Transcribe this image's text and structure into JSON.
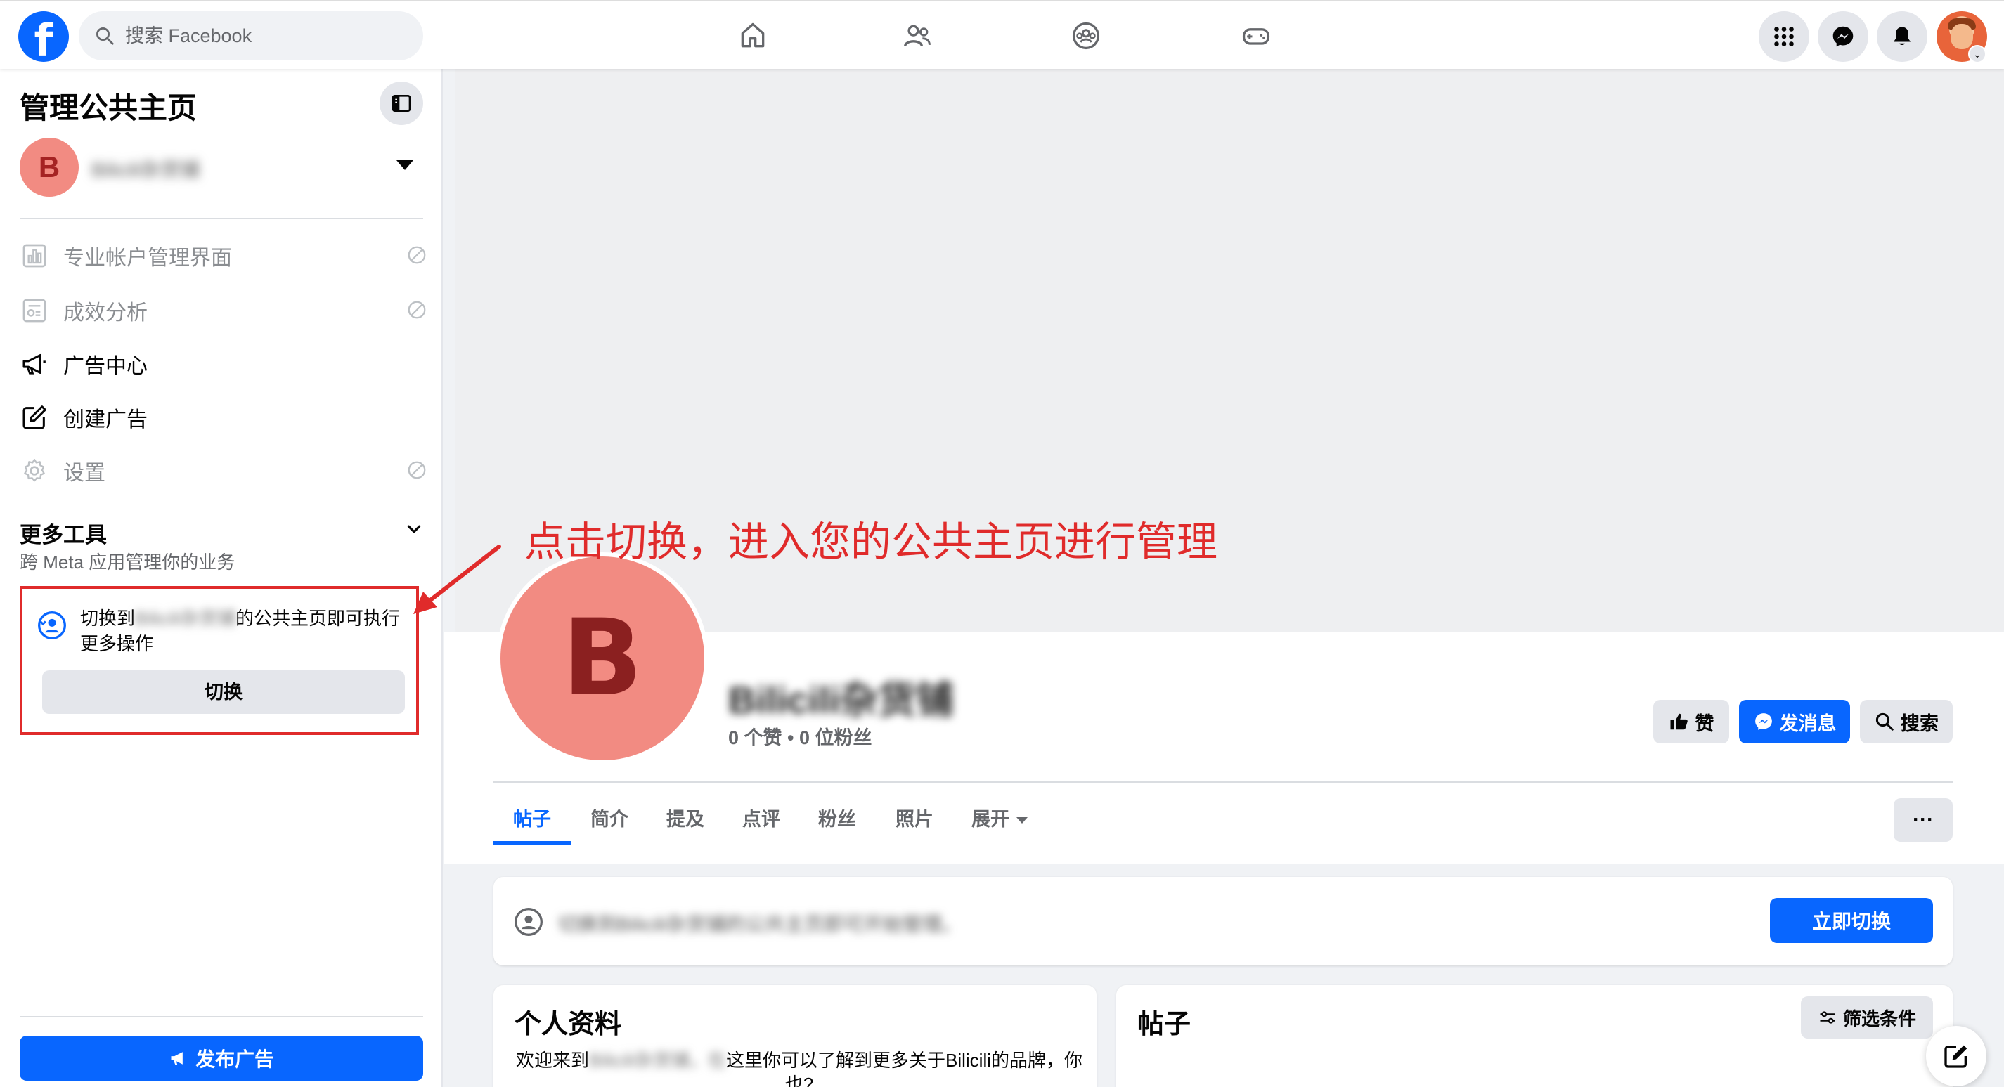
{
  "topbar": {
    "logo": "f",
    "search_placeholder": "搜索 Facebook",
    "nav_icons": [
      "home-icon",
      "friends-icon",
      "groups-icon",
      "gaming-icon"
    ],
    "right_icons": [
      "menu-grid-icon",
      "messenger-icon",
      "notifications-icon"
    ]
  },
  "sidebar": {
    "title": "管理公共主页",
    "page_initial": "B",
    "page_name": "Bilicili杂货铺",
    "items": [
      {
        "label": "专业帐户管理界面",
        "disabled": true,
        "icon": "dashboard-icon"
      },
      {
        "label": "成效分析",
        "disabled": true,
        "icon": "insights-icon"
      },
      {
        "label": "广告中心",
        "disabled": false,
        "icon": "megaphone-icon"
      },
      {
        "label": "创建广告",
        "disabled": false,
        "icon": "edit-icon"
      },
      {
        "label": "设置",
        "disabled": true,
        "icon": "settings-icon"
      }
    ],
    "more_tools": "更多工具",
    "more_tools_sub": "跨 Meta 应用管理你的业务",
    "switch_prefix": "切换到",
    "switch_blur": "Bilicili杂货铺",
    "switch_suffix": "的公共主页即可执行更多操作",
    "switch_button": "切换",
    "publish_ad": "发布广告"
  },
  "annotation": "点击切换，进入您的公共主页进行管理",
  "profile": {
    "initial": "B",
    "name": "Bilicili杂货铺",
    "stats": "0 个赞 • 0 位粉丝",
    "like_btn": "赞",
    "message_btn": "发消息",
    "search_btn": "搜索"
  },
  "tabs": [
    "帖子",
    "简介",
    "提及",
    "点评",
    "粉丝",
    "照片",
    "展开"
  ],
  "tab_more": "···",
  "switch_banner": {
    "text": "切换到Bilicili杂货铺的公共主页即可开始管理。",
    "button": "立即切换"
  },
  "profile_card": {
    "title": "个人资料",
    "desc_prefix": "欢迎来到",
    "desc_blur": "Bilicili杂货铺，在",
    "desc_suffix": "这里你可以了解到更多关于Bilicili的品牌，你也?"
  },
  "posts_card": {
    "title": "帖子",
    "filter": "筛选条件"
  },
  "colors": {
    "brand": "#0866ff",
    "annotation": "#e02b2b",
    "page_avatar": "#f28b82"
  }
}
